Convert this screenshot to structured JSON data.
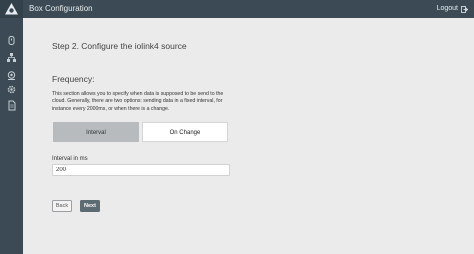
{
  "header": {
    "app_title": "Box Configuration",
    "logout_label": "Logout"
  },
  "sidebar": {
    "icons": [
      "gateway-icon",
      "network-icon",
      "connection-icon",
      "settings-gear-icon",
      "document-icon"
    ]
  },
  "main": {
    "step_title": "Step 2. Configure the iolink4 source",
    "section_title": "Frequency:",
    "description": "This section allows you to specify when data is supposed to be send to the cloud. Generally, there are two options: sending data in a fixed interval, for instance every 2000ms, or when there is a change.",
    "mode_options": {
      "interval": "Interval",
      "on_change": "On Change",
      "selected": "Interval"
    },
    "interval_field": {
      "label": "Interval in ms",
      "value": "200"
    },
    "buttons": {
      "back": "Back",
      "next": "Next"
    }
  },
  "colors": {
    "topbar": "#3b4a54",
    "selected_toggle": "#b7bbbd",
    "primary_button": "#5d6b73",
    "background": "#ebebeb"
  }
}
